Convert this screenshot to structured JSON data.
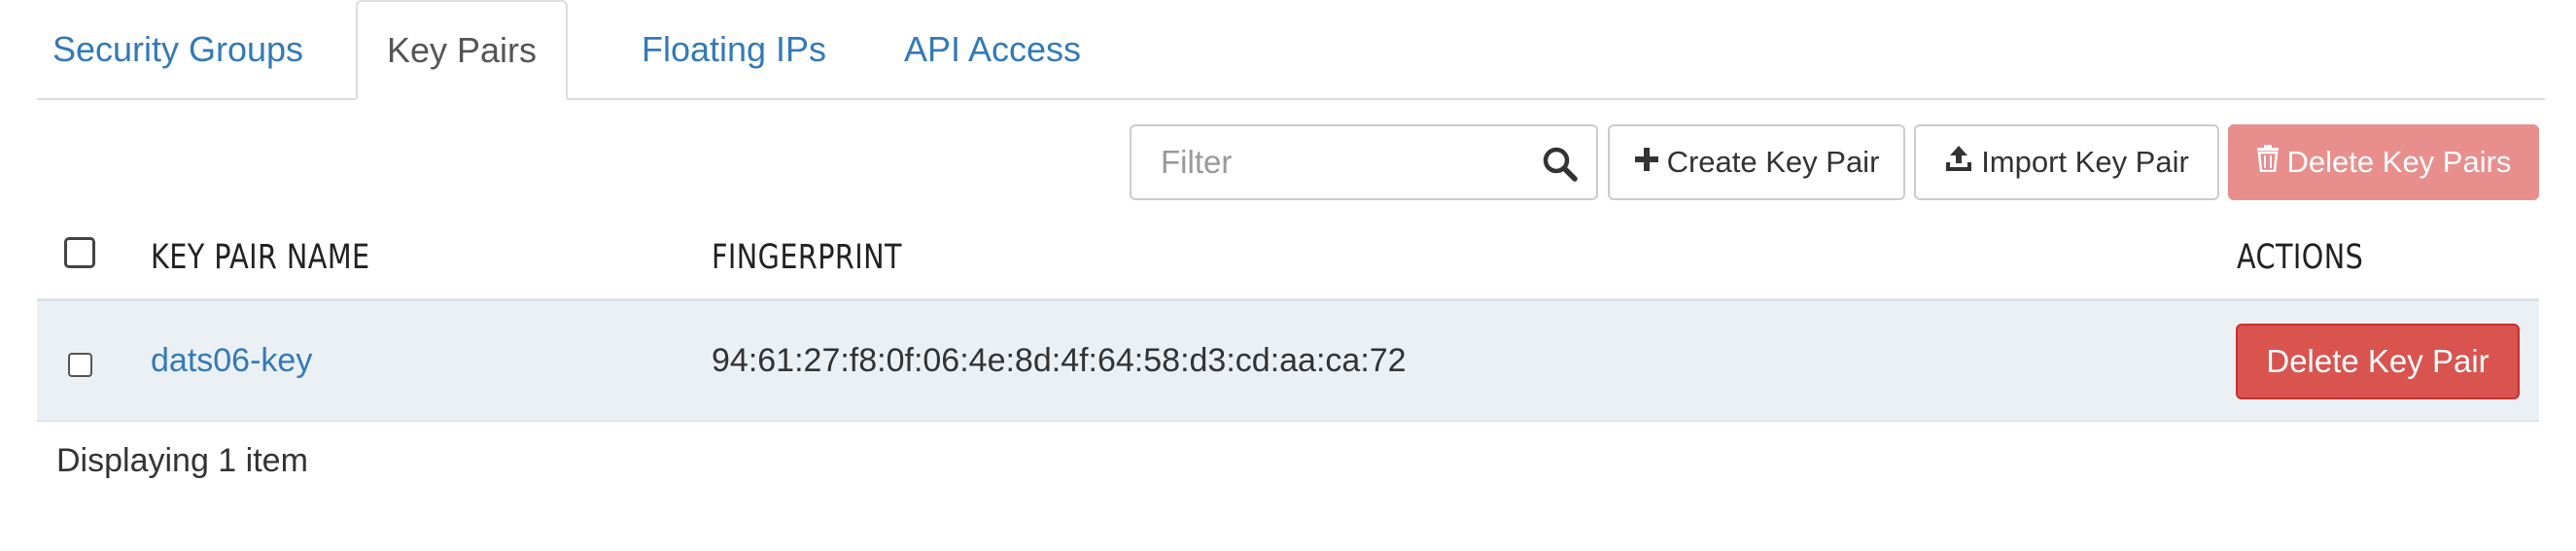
{
  "tabs": [
    {
      "label": "Security Groups",
      "active": false
    },
    {
      "label": "Key Pairs",
      "active": true
    },
    {
      "label": "Floating IPs",
      "active": false
    },
    {
      "label": "API Access",
      "active": false
    }
  ],
  "toolbar": {
    "filter_placeholder": "Filter",
    "filter_value": "",
    "search_icon": "search-icon",
    "create_label": "Create Key Pair",
    "create_icon": "plus-icon",
    "import_label": "Import Key Pair",
    "import_icon": "upload-icon",
    "delete_label": "Delete Key Pairs",
    "delete_icon": "trash-icon"
  },
  "table": {
    "columns": [
      "KEY PAIR NAME",
      "FINGERPRINT",
      "ACTIONS"
    ],
    "rows": [
      {
        "name": "dats06-key",
        "fingerprint": "94:61:27:f8:0f:06:4e:8d:4f:64:58:d3:cd:aa:ca:72",
        "action_label": "Delete Key Pair"
      }
    ],
    "footer": "Displaying 1 item"
  },
  "colors": {
    "link": "#337ab7",
    "danger": "#d9534f",
    "danger_disabled": "#e88f8d",
    "row_bg": "#ebf0f5"
  }
}
